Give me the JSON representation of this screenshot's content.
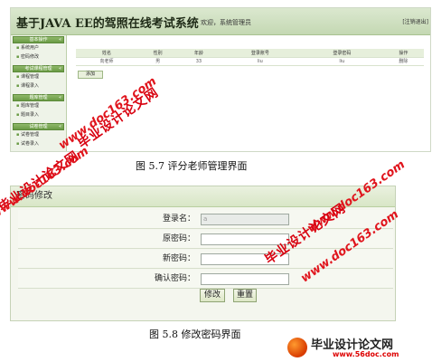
{
  "figure1": {
    "system_title": "基于JAVA EE的驾照在线考试系统",
    "welcome": "欢迎，系统管理员",
    "logout": "[注销退出]",
    "sidebar": [
      {
        "head": "基本操作",
        "items": [
          "系统用户",
          "密码修改"
        ]
      },
      {
        "head": "考试课程管理",
        "items": [
          "课程管理",
          "课程录入"
        ]
      },
      {
        "head": "题库管理",
        "items": [
          "题库管理",
          "题目录入"
        ]
      },
      {
        "head": "试卷管理",
        "items": [
          "试卷管理",
          "试卷录入"
        ]
      }
    ],
    "toggle_glyph": "«",
    "table": {
      "headers": [
        "姓名",
        "性别",
        "年龄",
        "登录账号",
        "登录密码",
        "操作"
      ],
      "rows": [
        [
          "向老师",
          "男",
          "33",
          "liu",
          "liu",
          "删除"
        ]
      ]
    },
    "add_label": "添加",
    "caption": "图 5.7 评分老师管理界面"
  },
  "figure2": {
    "panel_title": "密码修改",
    "fields": [
      {
        "label": "登录名：",
        "value": "a",
        "disabled": true
      },
      {
        "label": "原密码：",
        "value": "",
        "disabled": false
      },
      {
        "label": "新密码：",
        "value": "",
        "disabled": false
      },
      {
        "label": "确认密码：",
        "value": "",
        "disabled": false
      }
    ],
    "submit_label": "修改",
    "reset_label": "重置",
    "caption": "图 5.8 修改密码界面"
  },
  "watermarks": {
    "cn": "毕业设计论文网",
    "url": "www.doc163.com",
    "url2": "www.56doc.com",
    "logo_name": "毕业设计论文网"
  }
}
